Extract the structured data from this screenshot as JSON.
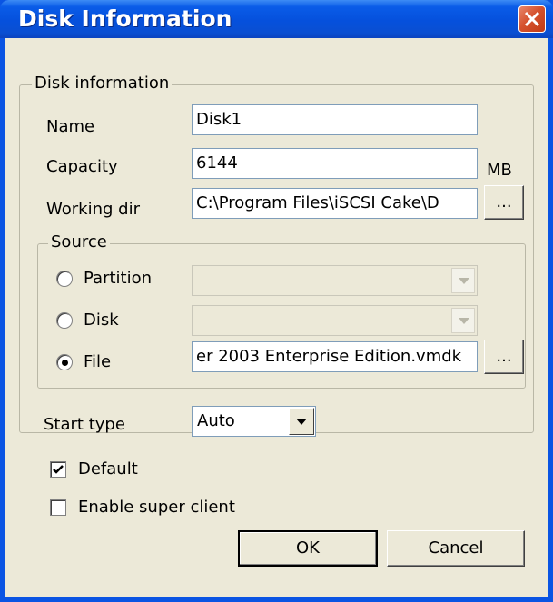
{
  "window": {
    "title": "Disk Information",
    "title_color": "#ffffff",
    "titlebar_color": "#0a54e3",
    "close_button_color": "#d5522e"
  },
  "disk_info_group": {
    "legend": "Disk information",
    "name_label": "Name",
    "name_value": "Disk1",
    "capacity_label": "Capacity",
    "capacity_value": "6144",
    "capacity_unit": "MB",
    "working_dir_label": "Working dir",
    "working_dir_value": "C:\\Program Files\\iSCSI Cake\\D",
    "browse_label": "..."
  },
  "source_group": {
    "legend": "Source",
    "partition_label": "Partition",
    "disk_label": "Disk",
    "file_label": "File",
    "selected": "File",
    "file_value": "er 2003 Enterprise Edition.vmdk",
    "browse_label": "..."
  },
  "start_type": {
    "label": "Start type",
    "value": "Auto"
  },
  "options": {
    "default_label": "Default",
    "default_checked": true,
    "super_client_label": "Enable super client",
    "super_client_checked": false
  },
  "buttons": {
    "ok": "OK",
    "cancel": "Cancel"
  }
}
